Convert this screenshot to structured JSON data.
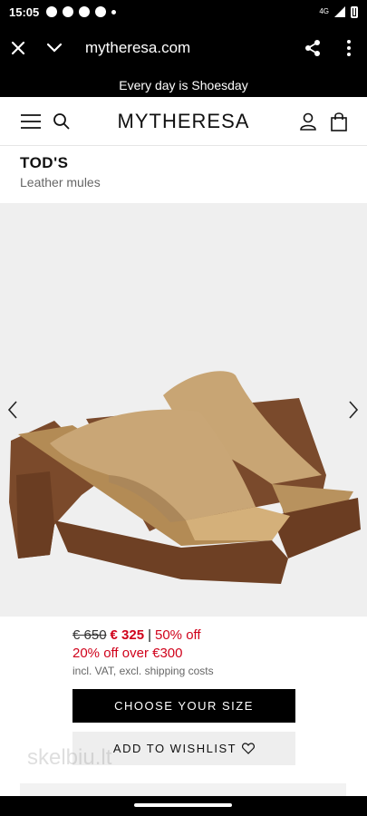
{
  "status_bar": {
    "time": "15:05",
    "network": "4G",
    "icons": [
      "messenger-icon",
      "app-icon",
      "chrome-icon",
      "chrome-icon",
      "more-dot-icon",
      "signal-icon",
      "battery-icon"
    ]
  },
  "browser": {
    "url": "mytheresa.com",
    "icons": [
      "close-icon",
      "chevron-down-icon",
      "share-icon",
      "kebab-menu-icon"
    ]
  },
  "promo": {
    "text": "Every day is Shoesday"
  },
  "header": {
    "logo": "MYTHERESA",
    "icons": [
      "hamburger-menu-icon",
      "search-icon",
      "account-icon",
      "shopping-bag-icon"
    ]
  },
  "product": {
    "brand": "TOD'S",
    "name": "Leather mules",
    "image": "product-image-tan-leather-platform-mules"
  },
  "pricing": {
    "old_price": "€ 650",
    "sale_price": "€ 325",
    "separator": "|",
    "discount": "50% off",
    "promo_discount": "20% off over €300",
    "vat_note": "incl. VAT, excl. shipping costs"
  },
  "actions": {
    "choose_size": "CHOOSE YOUR SIZE",
    "add_to_wishlist": "ADD TO WISHLIST"
  },
  "watermark": "skelbiu.lt",
  "colors": {
    "sale_red": "#d0021b",
    "primary_button": "#000000",
    "secondary_button": "#eeeeee",
    "image_background": "#efefef"
  }
}
